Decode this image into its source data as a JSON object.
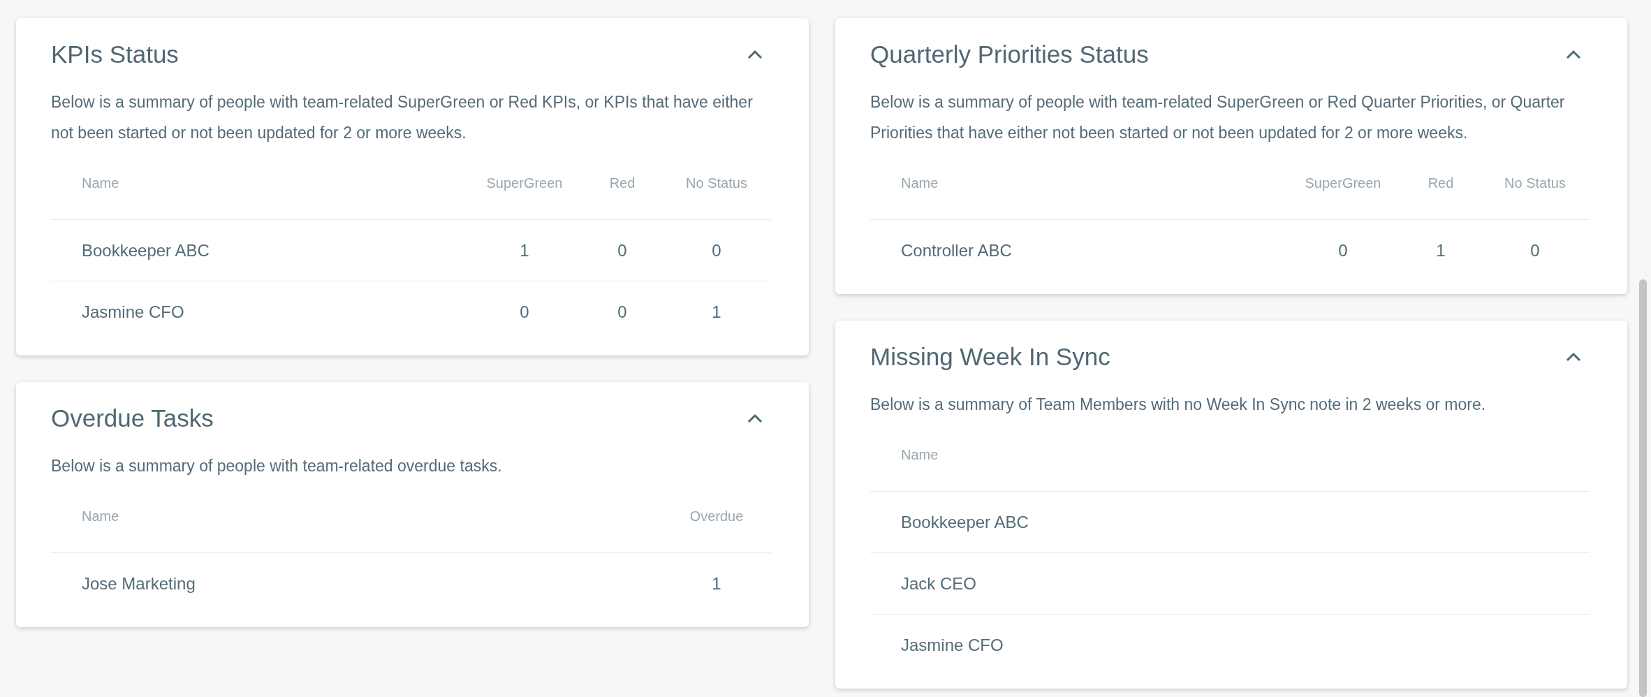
{
  "left_column": [
    {
      "title": "KPIs Status",
      "expanded": true,
      "description": "Below is a summary of people with team-related SuperGreen or Red KPIs, or KPIs that have either not been started or not been updated for 2 or more weeks.",
      "columns": [
        "Name",
        "SuperGreen",
        "Red",
        "No Status"
      ],
      "rows": [
        {
          "cells": [
            "Bookkeeper ABC",
            "1",
            "0",
            "0"
          ]
        },
        {
          "cells": [
            "Jasmine CFO",
            "0",
            "0",
            "1"
          ]
        }
      ]
    },
    {
      "title": "Overdue Tasks",
      "expanded": true,
      "description": "Below is a summary of people with team-related overdue tasks.",
      "columns": [
        "Name",
        "Overdue"
      ],
      "rows": [
        {
          "cells": [
            "Jose Marketing",
            "1"
          ]
        }
      ]
    }
  ],
  "right_column": [
    {
      "title": "Quarterly Priorities Status",
      "expanded": true,
      "description": "Below is a summary of people with team-related SuperGreen or Red Quarter Priorities, or Quarter Priorities that have either not been started or not been updated for 2 or more weeks.",
      "columns": [
        "Name",
        "SuperGreen",
        "Red",
        "No Status"
      ],
      "rows": [
        {
          "cells": [
            "Controller ABC",
            "0",
            "1",
            "0"
          ]
        }
      ]
    },
    {
      "title": "Missing Week In Sync",
      "expanded": true,
      "description": "Below is a summary of Team Members with no Week In Sync note in 2 weeks or more.",
      "columns": [
        "Name"
      ],
      "rows": [
        {
          "cells": [
            "Bookkeeper ABC"
          ]
        },
        {
          "cells": [
            "Jack CEO"
          ]
        },
        {
          "cells": [
            "Jasmine CFO"
          ]
        }
      ]
    }
  ]
}
